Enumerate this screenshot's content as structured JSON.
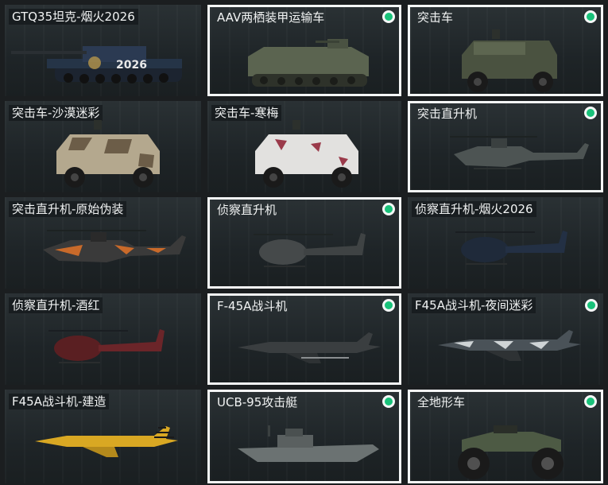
{
  "items": [
    {
      "label": "GTQ35坦克-烟火2026",
      "owned": false,
      "selected": false,
      "icon": "tank-icon",
      "decal": "2026"
    },
    {
      "label": "AAV两栖装甲运输车",
      "owned": true,
      "selected": true,
      "icon": "amphibious-vehicle-icon"
    },
    {
      "label": "突击车",
      "owned": true,
      "selected": true,
      "icon": "assault-vehicle-icon"
    },
    {
      "label": "突击车-沙漠迷彩",
      "owned": false,
      "selected": false,
      "icon": "assault-vehicle-icon"
    },
    {
      "label": "突击车-寒梅",
      "owned": false,
      "selected": false,
      "icon": "assault-vehicle-icon"
    },
    {
      "label": "突击直升机",
      "owned": true,
      "selected": true,
      "icon": "attack-helicopter-icon"
    },
    {
      "label": "突击直升机-原始伪装",
      "owned": false,
      "selected": false,
      "icon": "attack-helicopter-icon"
    },
    {
      "label": "侦察直升机",
      "owned": true,
      "selected": true,
      "icon": "scout-helicopter-icon"
    },
    {
      "label": "侦察直升机-烟火2026",
      "owned": false,
      "selected": false,
      "icon": "scout-helicopter-icon"
    },
    {
      "label": "侦察直升机-酒红",
      "owned": false,
      "selected": false,
      "icon": "scout-helicopter-icon"
    },
    {
      "label": "F-45A战斗机",
      "owned": true,
      "selected": true,
      "icon": "fighter-jet-icon"
    },
    {
      "label": "F45A战斗机-夜间迷彩",
      "owned": true,
      "selected": false,
      "icon": "fighter-jet-icon"
    },
    {
      "label": "F45A战斗机-建造",
      "owned": false,
      "selected": false,
      "icon": "fighter-jet-icon"
    },
    {
      "label": "UCB-95攻击艇",
      "owned": true,
      "selected": true,
      "icon": "attack-boat-icon"
    },
    {
      "label": "全地形车",
      "owned": true,
      "selected": true,
      "icon": "atv-icon"
    }
  ],
  "colors": {
    "owned_badge": "#19c27a",
    "selected_border": "#f4f6f6",
    "card_bg": "#22292c"
  }
}
